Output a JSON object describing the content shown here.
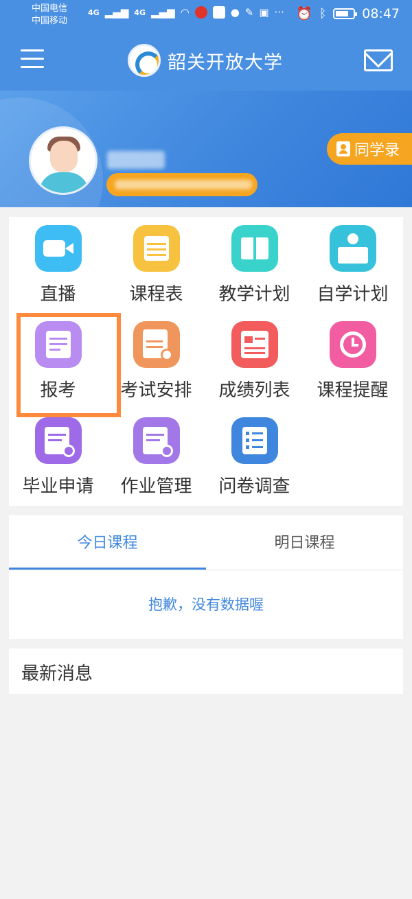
{
  "status_bar": {
    "carrier1": "中国电信",
    "carrier2": "中国移动",
    "network": "4G",
    "time": "08:47"
  },
  "header": {
    "title": "韶关开放大学"
  },
  "profile": {
    "classmates_label": "同学录"
  },
  "grid": [
    {
      "label": "直播",
      "icon": "video-camera-icon",
      "color": "#3dbdf3"
    },
    {
      "label": "课程表",
      "icon": "calendar-icon",
      "color": "#f7c240"
    },
    {
      "label": "教学计划",
      "icon": "book-icon",
      "color": "#3ad3cc"
    },
    {
      "label": "自学计划",
      "icon": "self-study-icon",
      "color": "#35c2da"
    },
    {
      "label": "报考",
      "icon": "exam-register-icon",
      "color": "#b88cf0"
    },
    {
      "label": "考试安排",
      "icon": "exam-schedule-icon",
      "color": "#f0965c"
    },
    {
      "label": "成绩列表",
      "icon": "score-list-icon",
      "color": "#f25c5c"
    },
    {
      "label": "课程提醒",
      "icon": "alarm-clock-icon",
      "color": "#f25ca0"
    },
    {
      "label": "毕业申请",
      "icon": "graduation-apply-icon",
      "color": "#9e6ae8"
    },
    {
      "label": "作业管理",
      "icon": "homework-icon",
      "color": "#a278e8"
    },
    {
      "label": "问卷调查",
      "icon": "survey-icon",
      "color": "#3f86de"
    }
  ],
  "tabs": {
    "today": "今日课程",
    "tomorrow": "明日课程"
  },
  "empty_message": "抱歉，没有数据喔",
  "news": {
    "title": "最新消息"
  }
}
